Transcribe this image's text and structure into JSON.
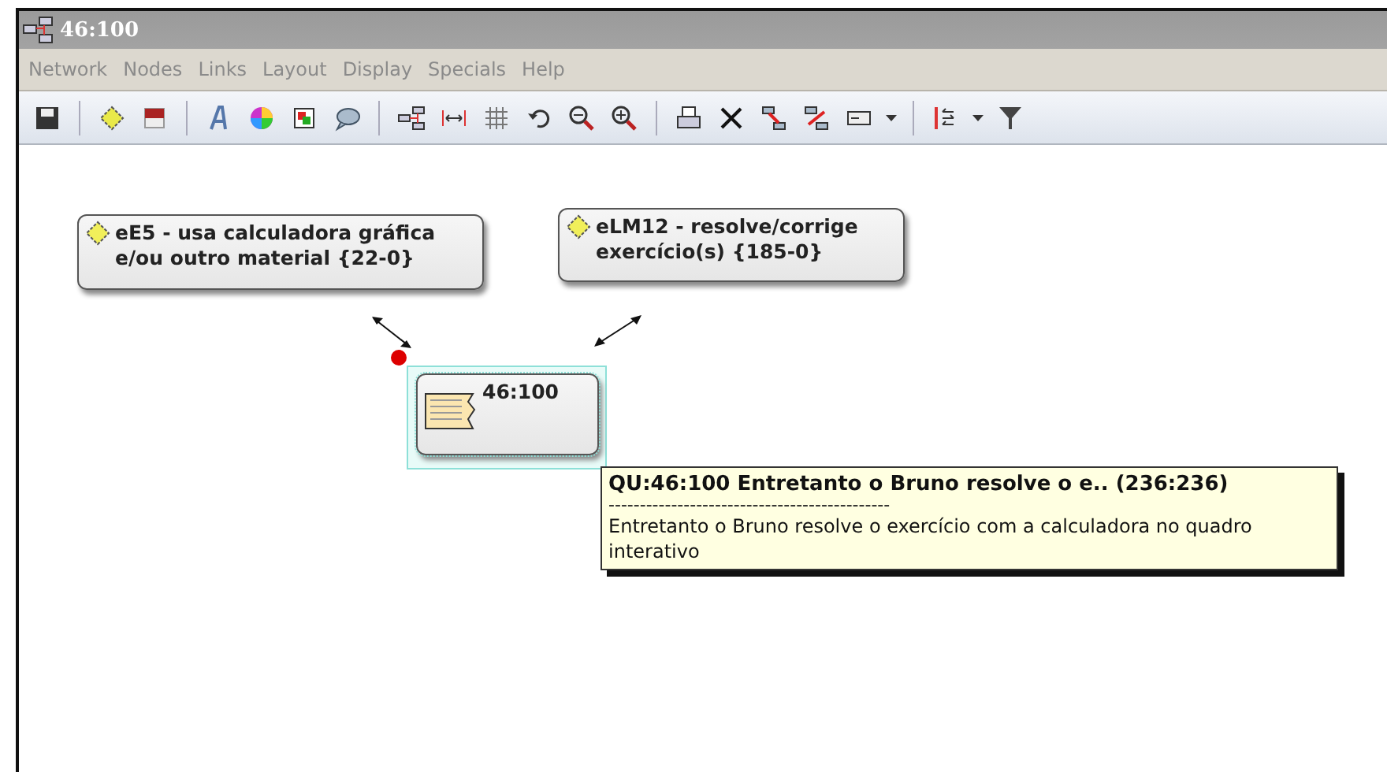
{
  "window": {
    "title": "46:100"
  },
  "menu": [
    "Network",
    "Nodes",
    "Links",
    "Layout",
    "Display",
    "Specials",
    "Help"
  ],
  "nodes": [
    {
      "kind": "code",
      "lines": [
        "eE5 - usa calculadora gráfica",
        "e/ou outro material {22-0}"
      ],
      "selected": false
    },
    {
      "kind": "code",
      "lines": [
        "eLM12 - resolve/corrige",
        "exercício(s) {185-0}"
      ],
      "selected": false
    },
    {
      "kind": "quotation",
      "lines": [
        "46:100"
      ],
      "selected": true
    }
  ],
  "tooltip": {
    "title": "QU:46:100 Entretanto o Bruno resolve o e.. (236:236)",
    "separator": "---------------------------------------------",
    "body": "Entretanto o Bruno resolve o exercício com a calculadora no quadro interativo"
  }
}
